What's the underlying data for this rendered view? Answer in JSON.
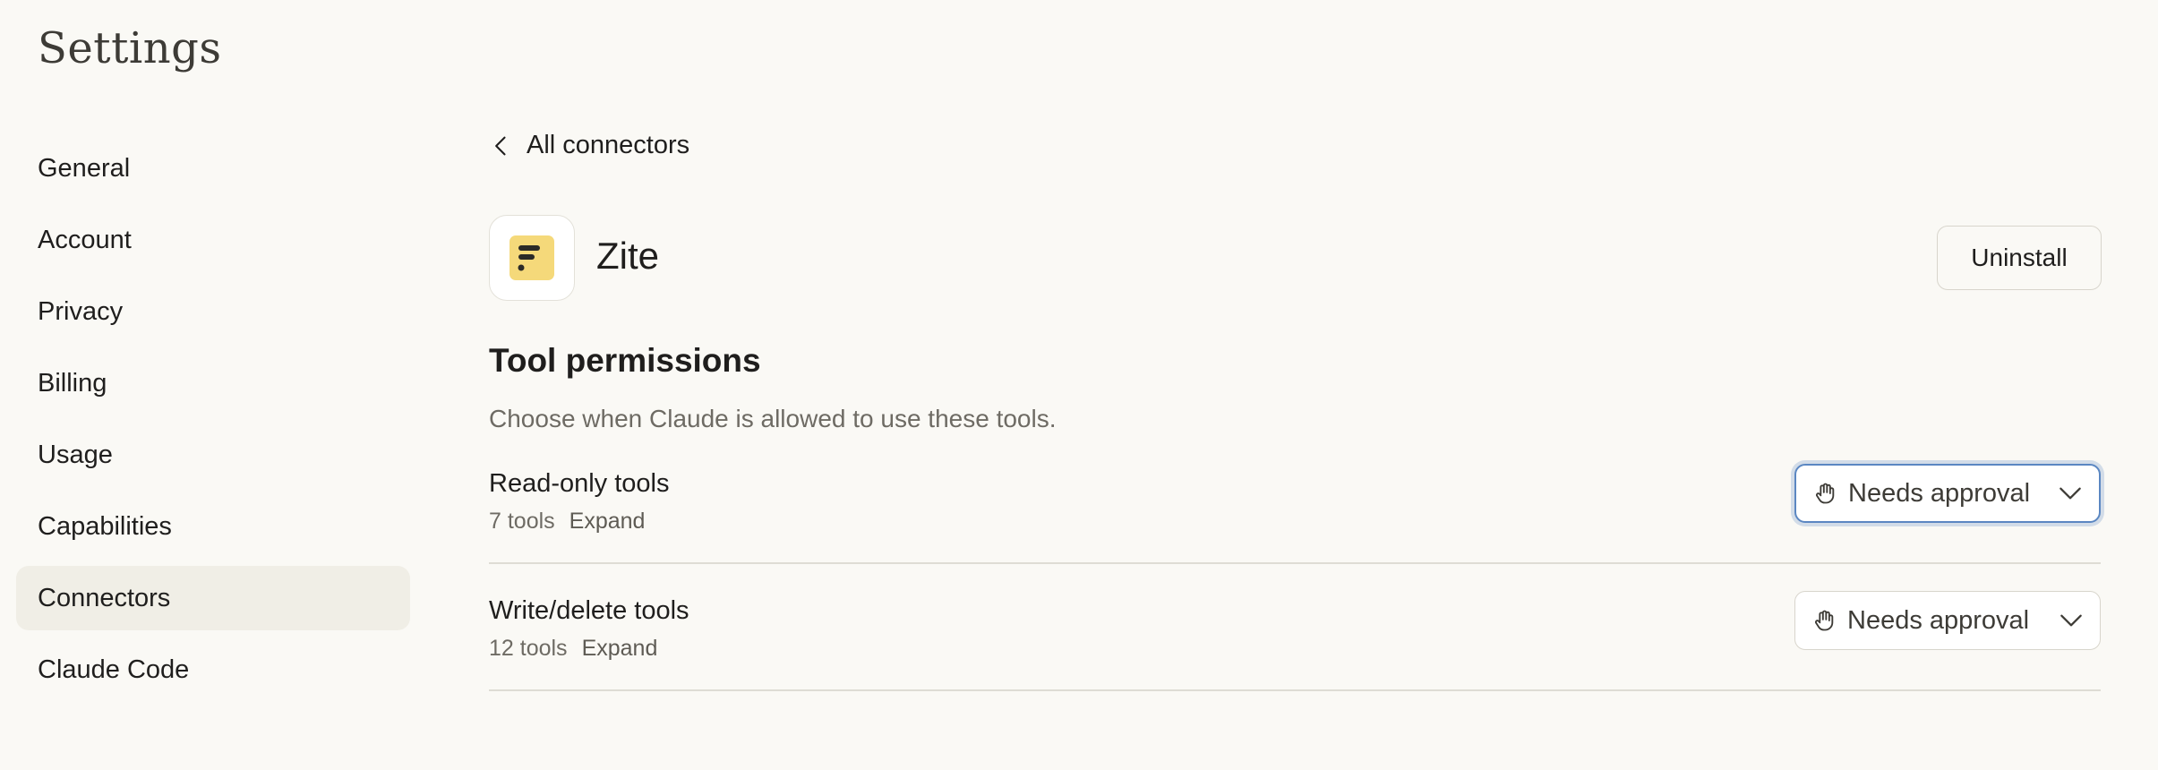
{
  "page_title": "Settings",
  "sidebar": {
    "items": [
      {
        "label": "General"
      },
      {
        "label": "Account"
      },
      {
        "label": "Privacy"
      },
      {
        "label": "Billing"
      },
      {
        "label": "Usage"
      },
      {
        "label": "Capabilities"
      },
      {
        "label": "Connectors",
        "active": true
      },
      {
        "label": "Claude Code"
      }
    ]
  },
  "main": {
    "back_link": "All connectors",
    "app": {
      "name": "Zite",
      "icon": "zite-logo-icon",
      "icon_color": "#f5d97a"
    },
    "uninstall_label": "Uninstall",
    "section_title": "Tool permissions",
    "section_desc": "Choose when Claude is allowed to use these tools.",
    "permissions": [
      {
        "name": "Read-only tools",
        "count": "7 tools",
        "expand": "Expand",
        "value": "Needs approval",
        "focused": true
      },
      {
        "name": "Write/delete tools",
        "count": "12 tools",
        "expand": "Expand",
        "value": "Needs approval",
        "focused": false
      }
    ]
  },
  "colors": {
    "background": "#faf9f5",
    "active_item": "#f0eee6",
    "focus_ring": "#5b87c2"
  }
}
